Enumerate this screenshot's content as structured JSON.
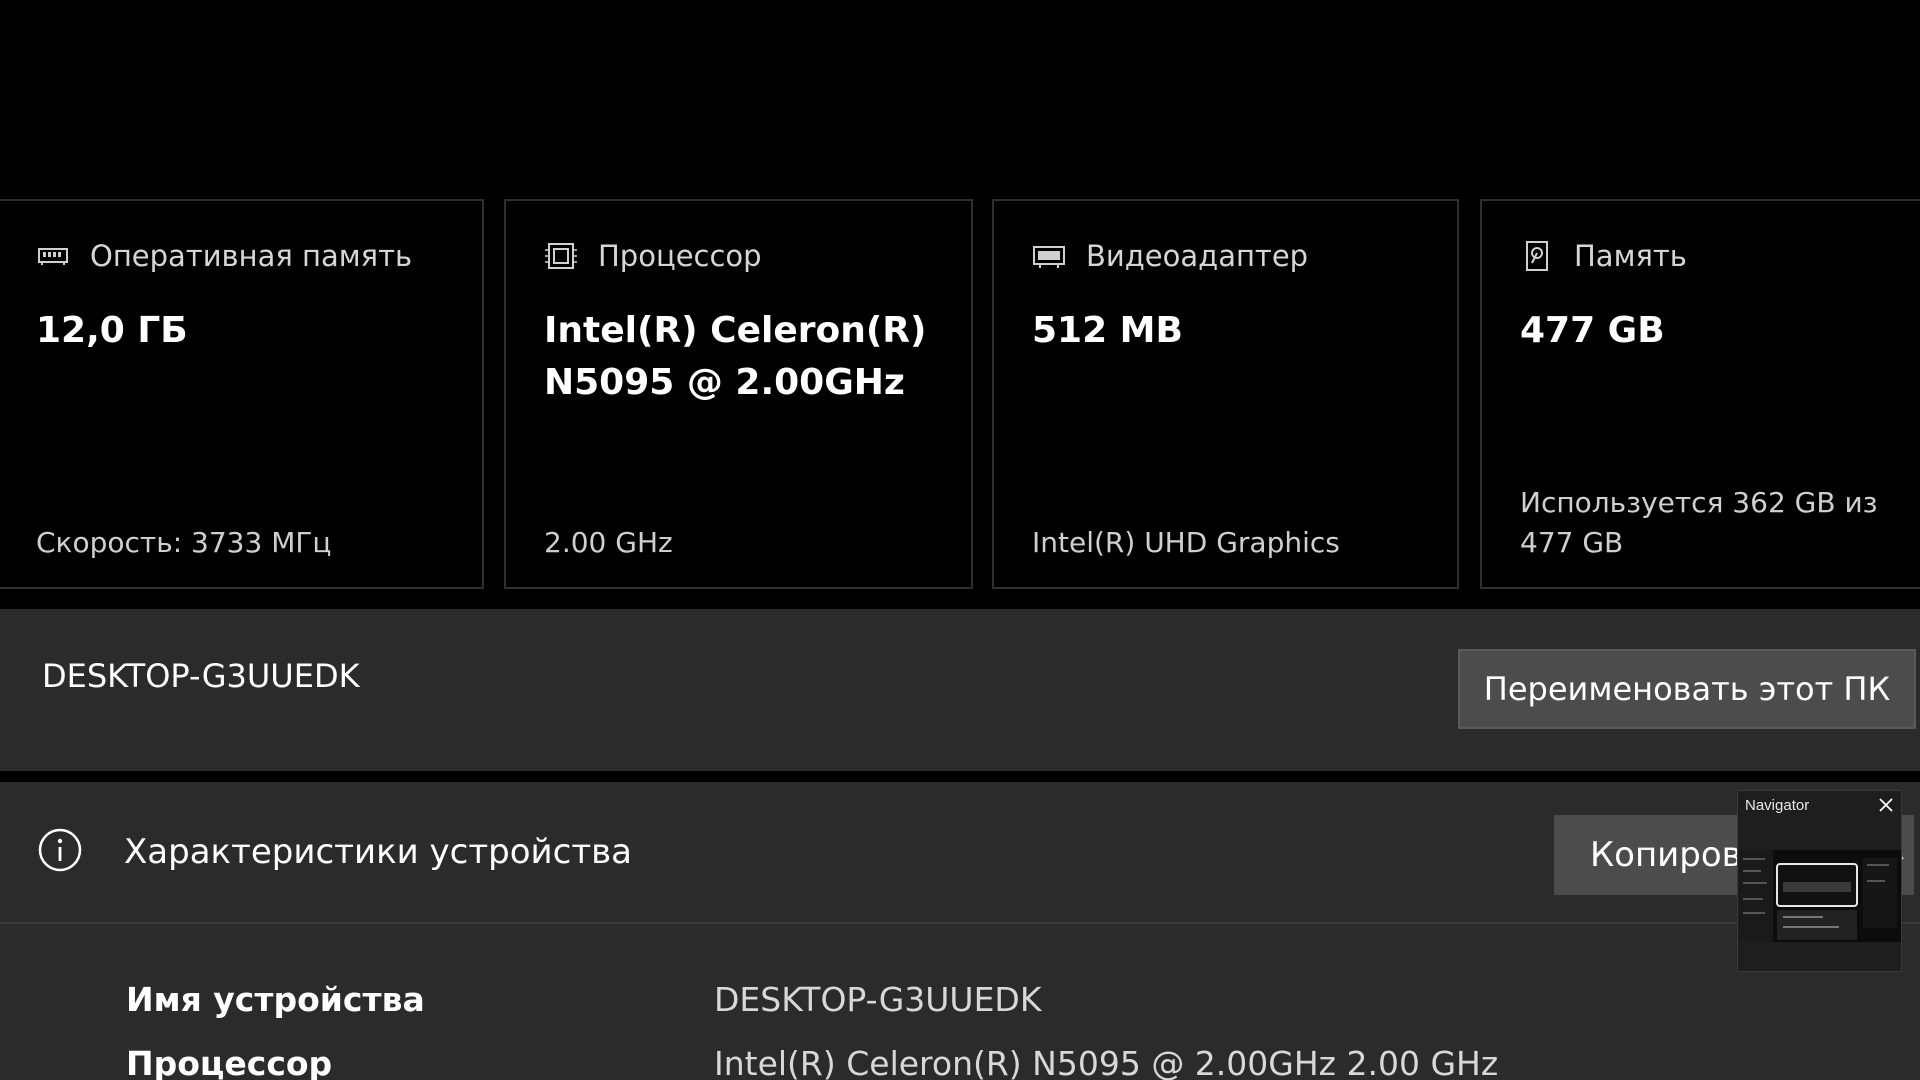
{
  "cards": {
    "ram": {
      "title": "Оперативная память",
      "value": "12,0 ГБ",
      "footer": "Скорость: 3733 МГц",
      "icon": "ram-icon"
    },
    "cpu": {
      "title": "Процессор",
      "value": "Intel(R) Celeron(R) N5095 @ 2.00GHz",
      "footer": "2.00 GHz",
      "icon": "processor-chip-icon"
    },
    "gpu": {
      "title": "Видеоадаптер",
      "value": "512 MB",
      "footer": "Intel(R) UHD Graphics",
      "icon": "graphics-card-icon"
    },
    "disk": {
      "title": "Память",
      "value": "477 GB",
      "footer": "Используется 362 GB из 477 GB",
      "icon": "storage-drive-icon"
    }
  },
  "rename": {
    "pc_name": "DESKTOP-G3UUEDK",
    "button_label": "Переименовать этот ПК"
  },
  "specs": {
    "title": "Характеристики устройства",
    "copy_label": "Копировать",
    "rows": [
      {
        "label": "Имя устройства",
        "value": "DESKTOP-G3UUEDK"
      },
      {
        "label": "Процессор",
        "value": "Intel(R) Celeron(R) N5095 @ 2.00GHz   2.00 GHz"
      }
    ]
  },
  "navigator": {
    "title": "Navigator"
  },
  "colors": {
    "background": "#000000",
    "panel": "#2b2b2b",
    "button": "#4c4c4c",
    "card_border": "#2f2f2f"
  }
}
